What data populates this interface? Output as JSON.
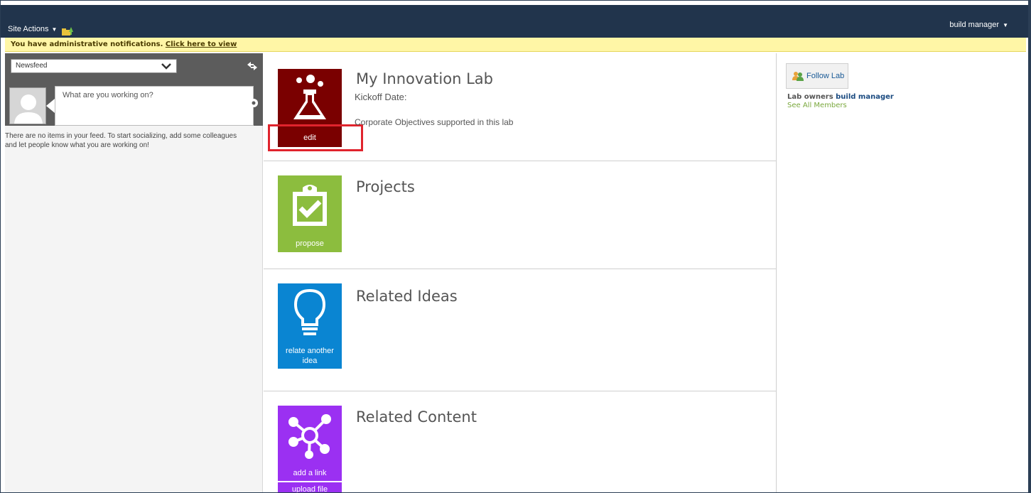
{
  "topbar": {
    "site_actions": "Site Actions",
    "user_name": "build manager"
  },
  "notification": {
    "message": "You have administrative notifications.",
    "link": "Click here to view"
  },
  "newsfeed": {
    "selected": "Newsfeed",
    "post_placeholder": "What are you working on?",
    "empty_message": "There are no items in your feed. To start socializing, add some colleagues and let people know what you are working on!"
  },
  "lab": {
    "title": "My Innovation Lab",
    "kickoff_label": "Kickoff Date:",
    "objectives_text": "Corporate Objectives supported in this lab",
    "edit_label": "edit",
    "tile_color": "#7a0000"
  },
  "projects": {
    "title": "Projects",
    "action": "propose",
    "tile_color": "#8cbd3e"
  },
  "ideas": {
    "title": "Related Ideas",
    "action": "relate another idea",
    "tile_color": "#0a85d2"
  },
  "content": {
    "title": "Related Content",
    "action_add": "add a link",
    "action_upload": "upload file",
    "tile_color": "#9b30f2"
  },
  "sidebar": {
    "follow_label": "Follow Lab",
    "owners_label": "Lab owners",
    "owner_name": "build manager",
    "see_all": "See All Members"
  }
}
